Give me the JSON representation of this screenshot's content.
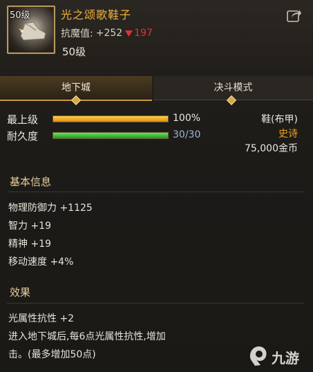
{
  "item": {
    "level_badge": "50级",
    "name": "光之颂歌鞋子",
    "resist_label": "抗魔值:",
    "resist_up": "+252",
    "resist_down": "197",
    "required_level": "50级"
  },
  "tabs": [
    {
      "label": "地下城",
      "active": true
    },
    {
      "label": "决斗模式",
      "active": false
    }
  ],
  "stats": {
    "max_level_label": "最上级",
    "max_level_value": "100%",
    "max_level_fraction": 1.0,
    "durability_label": "耐久度",
    "durability_value": "30/30",
    "durability_fraction": 1.0
  },
  "item_type": {
    "slot": "鞋(布甲)",
    "rarity": "史诗",
    "price": "75,000金币"
  },
  "basic_info": {
    "title": "基本信息",
    "lines": [
      "物理防御力 +1125",
      "智力 +19",
      "精神 +19",
      "移动速度 +4%"
    ]
  },
  "effects": {
    "title": "效果",
    "lines": [
      "光属性抗性 +2",
      "进入地下城后,每6点光属性抗性,增加",
      "击。(最多增加50点)"
    ]
  },
  "watermark": {
    "text": "九游"
  },
  "colors": {
    "gold_name": "#f0b23a",
    "down_red": "#e0323a",
    "orange_bar": "#f2a11e",
    "green_bar": "#2fbf3a",
    "durability_blue": "#9bb6d8",
    "rarity_orange": "#f0a020"
  }
}
